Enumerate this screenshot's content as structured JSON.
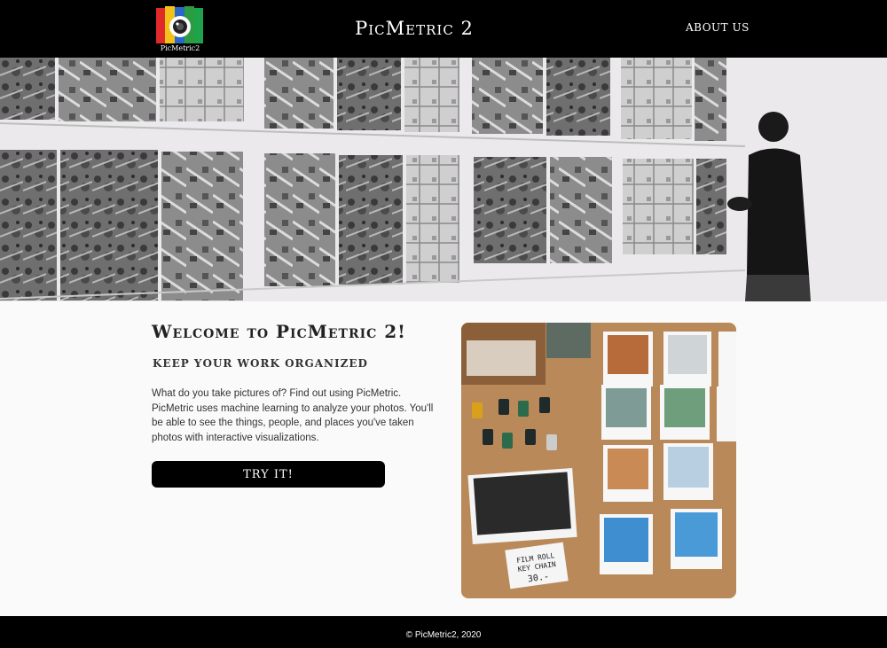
{
  "header": {
    "logo_text": "PicMetric2",
    "brand": "PicMetric 2",
    "nav": [
      {
        "label": "ABOUT US"
      }
    ]
  },
  "hero": {
    "image": "gallery-aerial-photos-with-man"
  },
  "main": {
    "title": "Welcome to PicMetric 2!",
    "subtitle": "KEEP YOUR WORK ORGANIZED",
    "description": "What do you take pictures of? Find out using PicMetric. PicMetric uses machine learning to analyze your photos. You'll be able to see the things, people, and places you've taken photos with interactive visualizations.",
    "cta_label": "TRY IT!",
    "photo": {
      "image": "polaroids-and-film-rolls",
      "sign_line1": "FILM ROLL",
      "sign_line2": "KEY CHAIN",
      "sign_price": "30.-"
    }
  },
  "footer": {
    "copyright": "© PicMetric2, 2020"
  },
  "colors": {
    "nav_bg": "#000000",
    "page_bg": "#fafafa",
    "button_bg": "#000000",
    "footer_bg": "#000000"
  }
}
